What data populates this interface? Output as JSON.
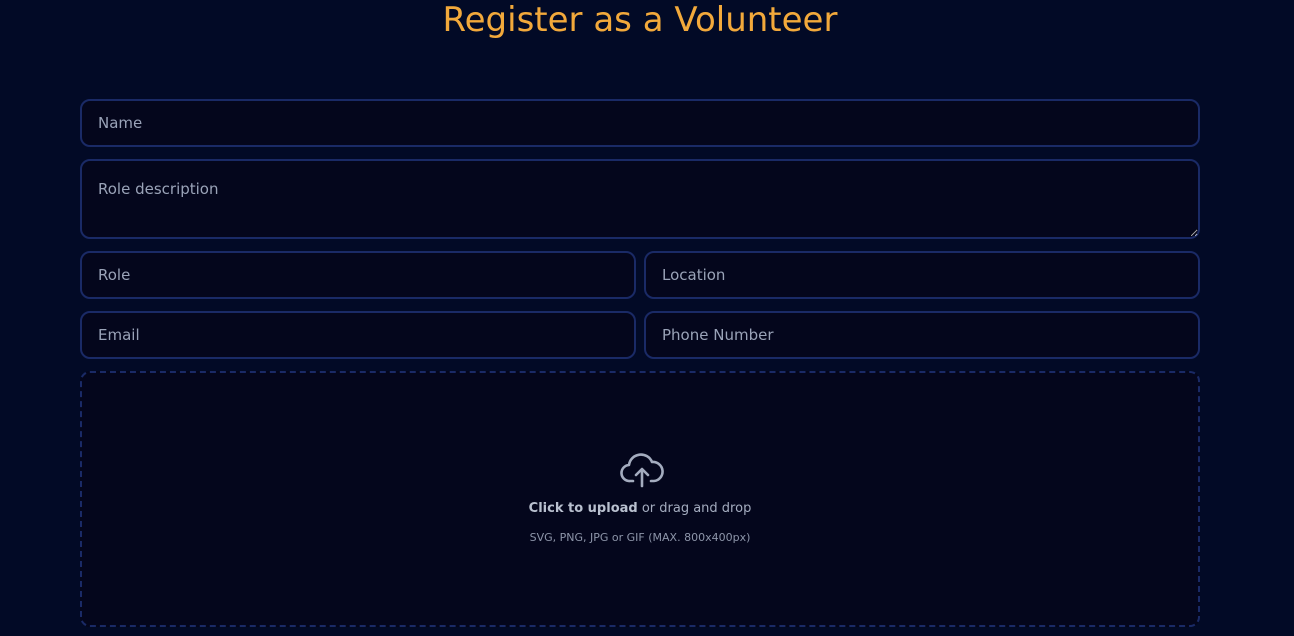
{
  "page": {
    "title": "Register as a Volunteer"
  },
  "form": {
    "name": {
      "placeholder": "Name",
      "value": ""
    },
    "role_description": {
      "placeholder": "Role description",
      "value": ""
    },
    "role": {
      "placeholder": "Role",
      "value": ""
    },
    "location": {
      "placeholder": "Location",
      "value": ""
    },
    "email": {
      "placeholder": "Email",
      "value": ""
    },
    "phone": {
      "placeholder": "Phone Number",
      "value": ""
    }
  },
  "upload": {
    "icon": "cloud-upload-icon",
    "click_label": "Click to upload",
    "drag_label": " or drag and drop",
    "hint": "SVG, PNG, JPG or GIF (MAX. 800x400px)"
  },
  "colors": {
    "background": "#020a26",
    "accent": "#f2a93b",
    "field_border": "#1a2a66",
    "field_bg": "#04061c"
  }
}
